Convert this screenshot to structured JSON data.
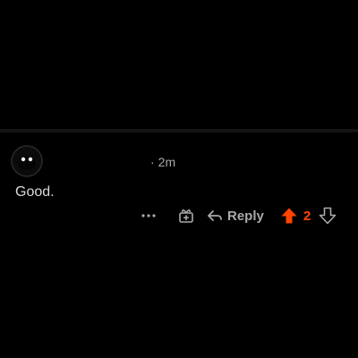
{
  "comment": {
    "timestamp": "2m",
    "meta_separator": "·",
    "body": "Good.",
    "reply_label": "Reply",
    "score": "2",
    "vote_state": "upvoted"
  },
  "colors": {
    "background": "#000000",
    "text": "#d7dadc",
    "muted": "#a7a9ab",
    "upvote_accent": "#ff4500",
    "divider": "#141414"
  },
  "icons": {
    "more": "more-horizontal-icon",
    "award": "award-icon",
    "reply": "reply-arrow-icon",
    "upvote": "upvote-arrow-icon",
    "downvote": "downvote-arrow-icon",
    "avatar": "avatar-icon"
  }
}
